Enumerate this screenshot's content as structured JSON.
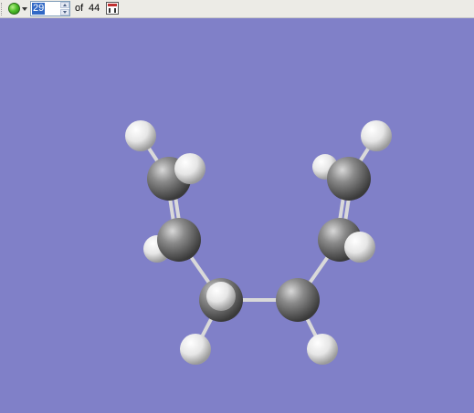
{
  "toolbar": {
    "current_frame": "29",
    "of_label": "of",
    "total_frames": "44",
    "icons": [
      "play-green-icon",
      "dropdown-arrow-icon",
      "spin-up-icon",
      "spin-down-icon",
      "movie-icon"
    ]
  },
  "viewport": {
    "background_color": "#8080c8",
    "atoms": {
      "carbon_color": "#7a7a7a",
      "hydrogen_color": "#f2f2f2"
    }
  }
}
